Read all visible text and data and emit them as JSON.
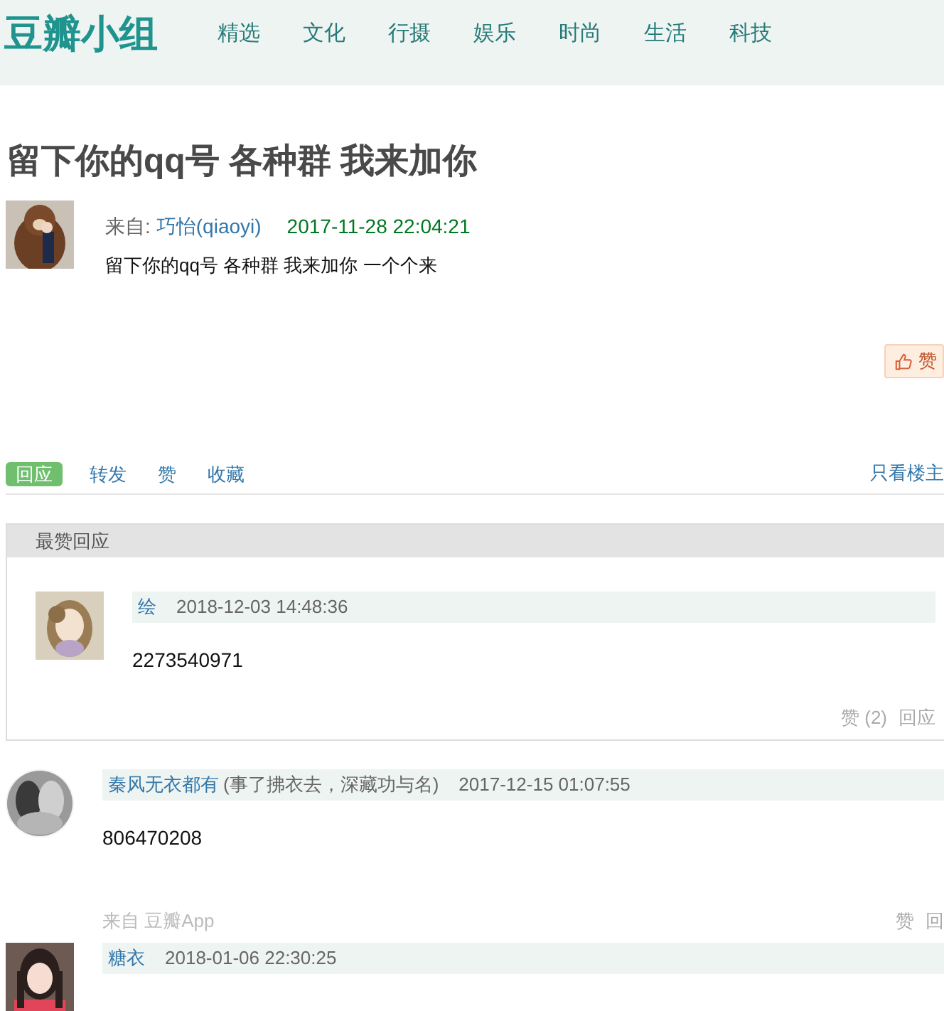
{
  "header": {
    "logo": "豆瓣小组",
    "nav": [
      {
        "label": "精选"
      },
      {
        "label": "文化"
      },
      {
        "label": "行摄"
      },
      {
        "label": "娱乐"
      },
      {
        "label": "时尚"
      },
      {
        "label": "生活"
      },
      {
        "label": "科技"
      }
    ]
  },
  "topic": {
    "title": "留下你的qq号 各种群 我来加你",
    "from_label": "来自:",
    "author": "巧怡(qiaoyi)",
    "time": "2017-11-28 22:04:21",
    "content": "留下你的qq号 各种群 我来加你 一个个来",
    "like_button": "赞"
  },
  "actions": [
    {
      "label": "回应",
      "selected": true
    },
    {
      "label": "转发",
      "selected": false
    },
    {
      "label": "赞",
      "selected": false
    },
    {
      "label": "收藏",
      "selected": false
    }
  ],
  "only_op": "只看楼主",
  "best_replies": {
    "title": "最赞回应",
    "items": [
      {
        "author": "绘",
        "time": "2018-12-03 14:48:36",
        "content": "2273540971",
        "round_avatar": false,
        "actions": [
          "赞 (2)",
          "回应"
        ]
      }
    ]
  },
  "replies": [
    {
      "author": "秦风无衣都有",
      "signature": "(事了拂衣去，深藏功与名)",
      "time": "2017-12-15 01:07:55",
      "content": "806470208",
      "round_avatar": true,
      "source": "来自 豆瓣App",
      "actions": [
        "赞",
        "回"
      ]
    },
    {
      "author": "糖衣",
      "time": "2018-01-06 22:30:25",
      "round_avatar": false
    }
  ]
}
